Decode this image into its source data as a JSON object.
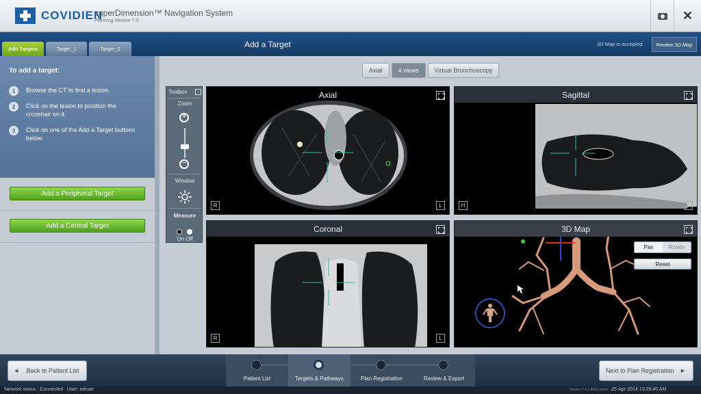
{
  "header": {
    "logo_text": "COVIDIEN",
    "app_title": "superDimension™ Navigation System",
    "app_subtitle": "Planning Version 7.0",
    "icons": [
      "camera-icon",
      "close-icon"
    ]
  },
  "tabbar": {
    "tabs": [
      {
        "label": "Add Targets",
        "active": true
      },
      {
        "label": "Target_1",
        "active": false
      },
      {
        "label": "Target_2",
        "active": false
      }
    ],
    "title": "Add a Target",
    "map_status": "3D Map is accepted",
    "review_button": "Review 3D Map"
  },
  "instructions": {
    "title": "To add a target:",
    "steps": [
      {
        "num": "1",
        "text": "Browse the CT to find a lesion."
      },
      {
        "num": "2",
        "text": "Click on the lesion to position the crosshair on it."
      },
      {
        "num": "3",
        "text": "Click on one of the Add a Target buttons below."
      }
    ]
  },
  "actions": {
    "peripheral": "Add a Peripheral Target",
    "central": "Add a Central Target"
  },
  "view_tabs": [
    {
      "label": "Axial",
      "selected": false
    },
    {
      "label": "4 views",
      "selected": true
    },
    {
      "label": "Virtual Bronchoscopy",
      "selected": false
    }
  ],
  "toolbox": {
    "title": "Toolbox",
    "collapse": "-",
    "zoom_label": "Zoom",
    "zoom_in": "+",
    "zoom_out": "−",
    "window_label": "Window",
    "measure_label": "Measure",
    "measure_state": "On Off"
  },
  "viewports": {
    "axial": {
      "title": "Axial",
      "left": "R",
      "right": "L"
    },
    "sagittal": {
      "title": "Sagittal",
      "left": "H",
      "right": "F"
    },
    "coronal": {
      "title": "Coronal",
      "left": "R",
      "right": "L"
    },
    "map3d": {
      "title": "3D Map",
      "pan": "Pan",
      "rotate": "Rotate",
      "reset": "Reset"
    }
  },
  "footer": {
    "back": "Back to Patient List",
    "next": "Next to Plan Registration",
    "workflow": [
      {
        "label": "Patient List",
        "current": false
      },
      {
        "label": "Targets & Pathways",
        "current": true
      },
      {
        "label": "Plan Registration",
        "current": false
      },
      {
        "label": "Review & Export",
        "current": false
      }
    ]
  },
  "status": {
    "network": "Network status : Connected",
    "user": "User:  sduser",
    "version": "Version 7.0.1.4635.14447",
    "datetime": "25-Apr-2014 10:29:40 AM"
  },
  "colors": {
    "brand": "#1b5fa8",
    "accent_green": "#6fa61c",
    "header_blue": "#1f5088"
  }
}
